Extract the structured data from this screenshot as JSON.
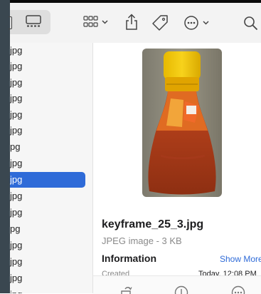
{
  "sidebar": {
    "items": [
      {
        "label": "jpg"
      },
      {
        "label": "jpg"
      },
      {
        "label": "jpg"
      },
      {
        "label": "jpg"
      },
      {
        "label": "jpg"
      },
      {
        "label": "jpg"
      },
      {
        "label": "pg"
      },
      {
        "label": "jpg"
      },
      {
        "label": "jpg",
        "selected": true
      },
      {
        "label": "jpg"
      },
      {
        "label": "jpg"
      },
      {
        "label": "pg"
      },
      {
        "label": "jpg"
      },
      {
        "label": "jpg"
      },
      {
        "label": "jpg"
      },
      {
        "label": "ipg"
      }
    ]
  },
  "preview": {
    "file_name": "keyframe_25_3.jpg",
    "file_type": "JPEG image - 3 KB",
    "info_heading": "Information",
    "show_more": "Show More",
    "created_label": "Created",
    "created_value": "Today, 12:08 PM"
  },
  "colors": {
    "accent": "#2f6bd8",
    "sidebar_bg": "#f6f6f6",
    "toolbar_bg": "#f3f3f3"
  }
}
